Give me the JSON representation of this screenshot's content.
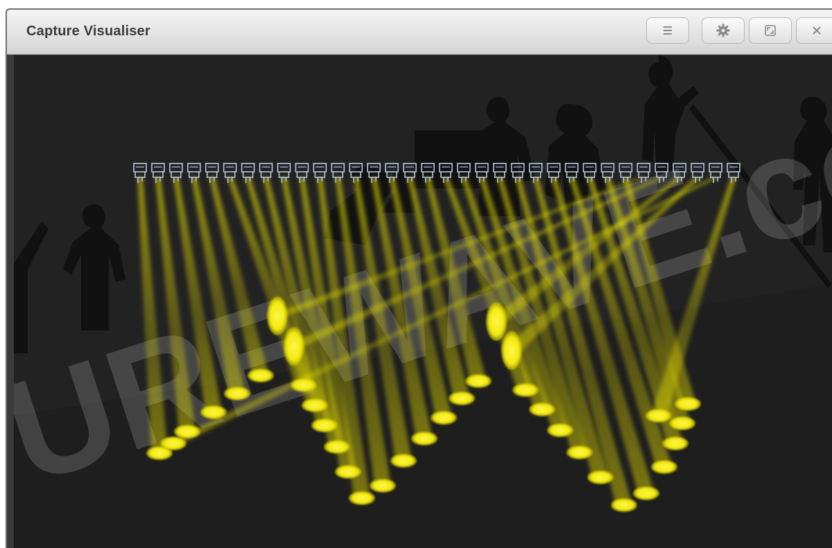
{
  "window": {
    "title": "Capture Visualiser"
  },
  "titlebar_buttons": [
    {
      "name": "menu-button",
      "icon": "menu-icon"
    },
    {
      "name": "settings-button",
      "icon": "gear-icon"
    },
    {
      "name": "maximize-button",
      "icon": "maximize-icon"
    },
    {
      "name": "close-button",
      "icon": "close-icon"
    }
  ],
  "scene": {
    "fixture_count": 34,
    "beam_color": "#e8e000",
    "fixture_color": "#b8c8e0",
    "floor_color": "#1e1e1e",
    "back_wall_color": "#1a1a1a"
  },
  "watermark": {
    "text": "UREWAVE.co"
  }
}
